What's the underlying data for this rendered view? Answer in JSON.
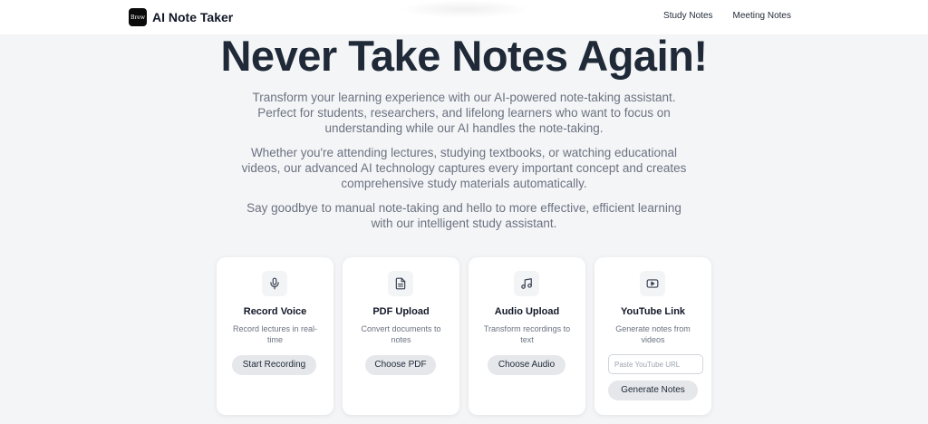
{
  "header": {
    "logo_text": "Brew",
    "brand": "AI Note Taker",
    "nav": [
      {
        "label": "Study Notes"
      },
      {
        "label": "Meeting Notes"
      }
    ]
  },
  "hero": {
    "title": "Never Take Notes Again!",
    "paragraphs": [
      "Transform your learning experience with our AI-powered note-taking assistant. Perfect for students, researchers, and lifelong learners who want to focus on understanding while our AI handles the note-taking.",
      "Whether you're attending lectures, studying textbooks, or watching educational videos, our advanced AI technology captures every important concept and creates comprehensive study materials automatically.",
      "Say goodbye to manual note-taking and hello to more effective, efficient learning with our intelligent study assistant."
    ]
  },
  "cards": [
    {
      "icon": "microphone-icon",
      "title": "Record Voice",
      "description": "Record lectures in real-time",
      "button": "Start Recording"
    },
    {
      "icon": "document-icon",
      "title": "PDF Upload",
      "description": "Convert documents to notes",
      "button": "Choose PDF"
    },
    {
      "icon": "music-note-icon",
      "title": "Audio Upload",
      "description": "Transform recordings to text",
      "button": "Choose Audio"
    },
    {
      "icon": "play-icon",
      "title": "YouTube Link",
      "description": "Generate notes from videos",
      "input_placeholder": "Paste YouTube URL",
      "input_value": "",
      "button": "Generate Notes"
    }
  ]
}
